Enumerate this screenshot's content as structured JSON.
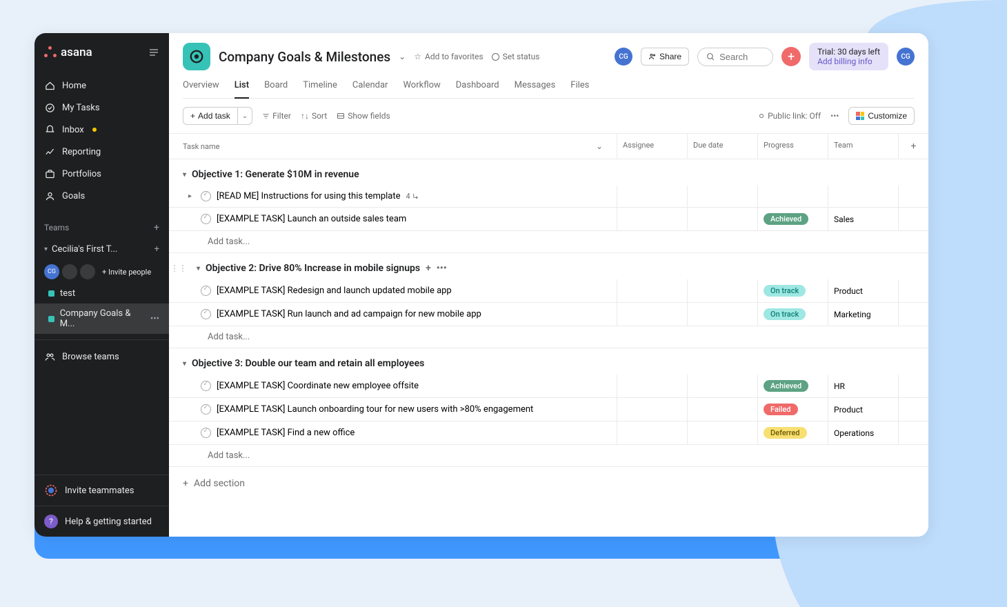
{
  "brand": "asana",
  "user_initials": "CG",
  "nav": {
    "home": "Home",
    "my_tasks": "My Tasks",
    "inbox": "Inbox",
    "reporting": "Reporting",
    "portfolios": "Portfolios",
    "goals": "Goals"
  },
  "teams": {
    "header": "Teams",
    "team_name": "Cecilia's First T...",
    "invite_people": "Invite people",
    "projects": {
      "test": "test",
      "company_goals": "Company Goals & M..."
    },
    "browse": "Browse teams"
  },
  "footer": {
    "invite": "Invite teammates",
    "help": "Help & getting started"
  },
  "header": {
    "project_title": "Company Goals & Milestones",
    "add_favorites": "Add to favorites",
    "set_status": "Set status",
    "share": "Share",
    "search_placeholder": "Search",
    "trial_line1": "Trial: 30 days left",
    "trial_line2": "Add billing info"
  },
  "tabs": {
    "overview": "Overview",
    "list": "List",
    "board": "Board",
    "timeline": "Timeline",
    "calendar": "Calendar",
    "workflow": "Workflow",
    "dashboard": "Dashboard",
    "messages": "Messages",
    "files": "Files"
  },
  "toolbar": {
    "add_task": "Add task",
    "filter": "Filter",
    "sort": "Sort",
    "show_fields": "Show fields",
    "public_link": "Public link: Off",
    "customize": "Customize"
  },
  "columns": {
    "task": "Task name",
    "assignee": "Assignee",
    "due": "Due date",
    "progress": "Progress",
    "team": "Team"
  },
  "sections": [
    {
      "title": "Objective 1: Generate $10M in revenue",
      "tasks": [
        {
          "name": "[READ ME] Instructions for using this template",
          "subtasks": "4",
          "progress": "",
          "team": "",
          "expandable": true
        },
        {
          "name": "[EXAMPLE TASK] Launch an outside sales team",
          "progress": "Achieved",
          "progress_class": "achieved",
          "team": "Sales"
        }
      ]
    },
    {
      "title": "Objective 2: Drive 80% Increase in mobile signups",
      "show_actions": true,
      "tasks": [
        {
          "name": "[EXAMPLE TASK] Redesign and launch updated mobile app",
          "progress": "On track",
          "progress_class": "ontrack",
          "team": "Product"
        },
        {
          "name": "[EXAMPLE TASK] Run launch and ad campaign for new mobile app",
          "progress": "On track",
          "progress_class": "ontrack",
          "team": "Marketing"
        }
      ]
    },
    {
      "title": "Objective 3: Double our team and retain all employees",
      "tasks": [
        {
          "name": "[EXAMPLE TASK] Coordinate new employee offsite",
          "progress": "Achieved",
          "progress_class": "achieved",
          "team": "HR"
        },
        {
          "name": "[EXAMPLE TASK] Launch onboarding tour for new users with >80% engagement",
          "progress": "Failed",
          "progress_class": "failed",
          "team": "Product"
        },
        {
          "name": "[EXAMPLE TASK] Find a new office",
          "progress": "Deferred",
          "progress_class": "deferred",
          "team": "Operations"
        }
      ]
    }
  ],
  "add_task_link": "Add task...",
  "add_section": "Add section"
}
